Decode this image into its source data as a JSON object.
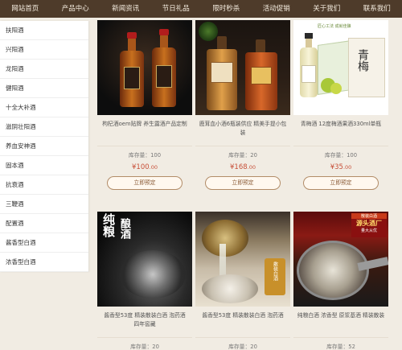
{
  "nav": {
    "items": [
      "网站首页",
      "产品中心",
      "新闻资讯",
      "节日礼品",
      "限时秒杀",
      "活动促销",
      "关于我们",
      "联系我们"
    ]
  },
  "sidebar": {
    "items": [
      "扶阳酒",
      "兴阳酒",
      "龙阳酒",
      "健阳酒",
      "十全大补酒",
      "滋阴壮阳酒",
      "养血安神酒",
      "固本酒",
      "抗衰酒",
      "三鞭酒",
      "配置酒",
      "酱香型白酒",
      "浓香型白酒"
    ]
  },
  "products": [
    {
      "title": "枸杞酒oem贴牌 养生露酒产品定制",
      "stock": "库存量：100",
      "price": "100",
      "cents": ".00",
      "button": "立即预定"
    },
    {
      "title": "鹿茸血小酒6瓶装供应 精美手提小包装",
      "stock": "库存量：20",
      "price": "168",
      "cents": ".00",
      "button": "立即预定"
    },
    {
      "title": "青梅酒 12度梅酒果酒330ml单瓶",
      "stock": "库存量：100",
      "price": "35",
      "cents": ".00",
      "button": "立即预定"
    },
    {
      "title": "酱香型53度 精装散装白酒 泡药酒 四年窖藏",
      "stock": "库存量：20"
    },
    {
      "title": "酱香型53度 精装散装白酒 泡药酒",
      "stock": "库存量：20"
    },
    {
      "title": "纯粮白酒 浓香型 原浆基酒 精装散装",
      "stock": "库存量：52"
    }
  ],
  "image_text": {
    "p3_brand": "青梅",
    "p3_sub": "匠心工法 成就佳酿",
    "p4_big": "纯粮",
    "p4_sub": "酿酒",
    "p5_tag": "散装白酒",
    "p6_top": "散装白酒",
    "p6_main": "源头酒厂",
    "p6_sub": "量大从优"
  },
  "currency": "¥"
}
